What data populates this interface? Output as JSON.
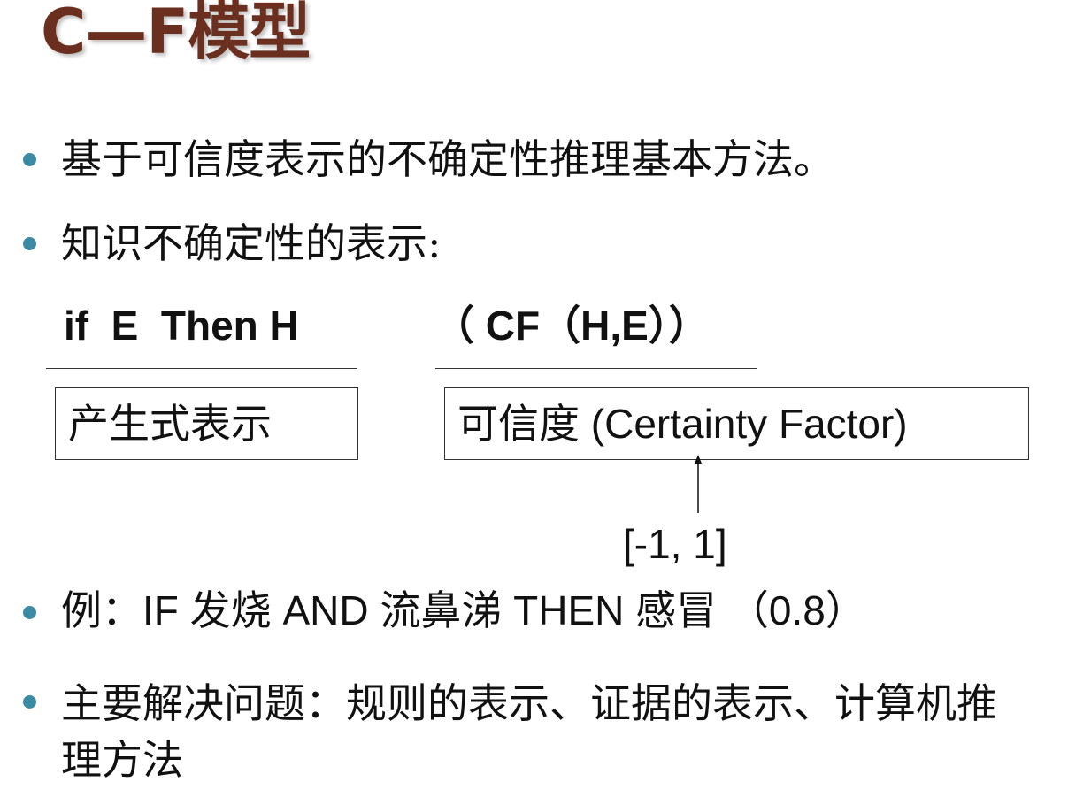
{
  "slide": {
    "title": "C—F模型",
    "bullet1": "基于可信度表示的不确定性推理基本方法。",
    "bullet2": "知识不确定性的表示:",
    "formula_left": "if  E  Then H",
    "formula_right": "（ CF（H,E））",
    "box_left": "产生式表示",
    "box_right": "可信度 (Certainty Factor)",
    "range_label": "[-1, 1]",
    "example": {
      "prefix": "例：IF  发烧 AND 流鼻涕 THEN  感冒",
      "value": "（0.8）"
    },
    "bullet4": "主要解决问题：规则的表示、证据的表示、计算机推理方法",
    "colors": {
      "title": "#6b2f1f",
      "bullet": "#3d8aa3"
    }
  }
}
